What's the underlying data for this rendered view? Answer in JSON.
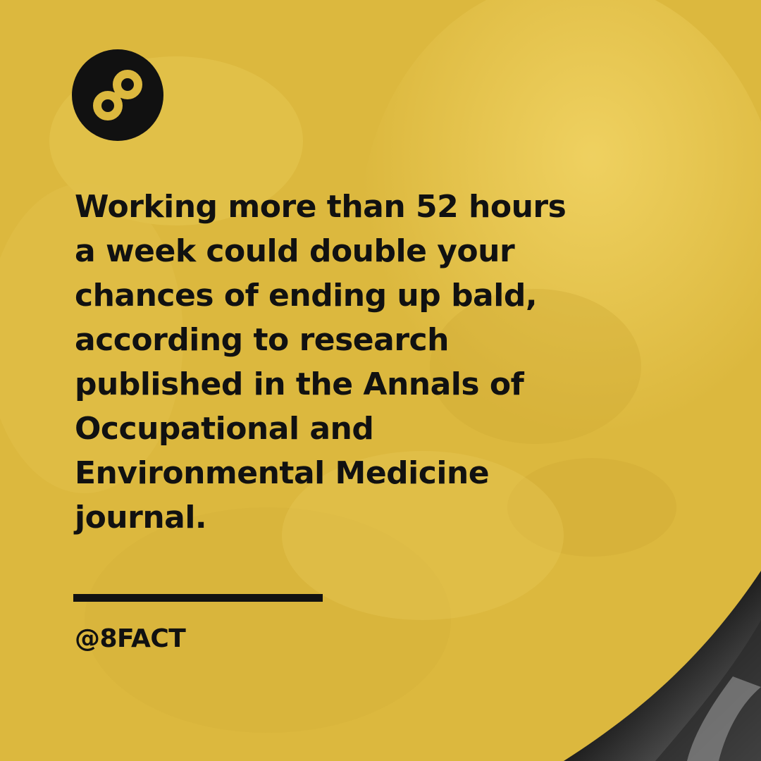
{
  "brand": {
    "logo_icon": "infinity-8-icon",
    "handle": "@8FACT"
  },
  "fact": {
    "lines": [
      "Working more than 52 hours",
      "a week could double your",
      "chances of ending up bald,",
      "according to research",
      "published in the Annals of",
      "Occupational and",
      "Environmental Medicine",
      "journal."
    ]
  },
  "colors": {
    "background_yellow": "#dcb83e",
    "text_black": "#111111"
  }
}
